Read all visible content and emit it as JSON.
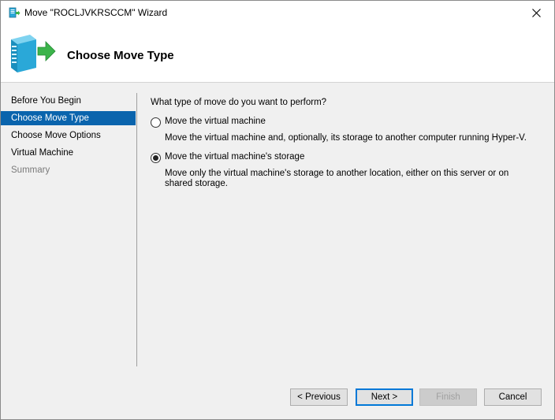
{
  "window": {
    "title": "Move \"ROCLJVKRSCCM\" Wizard",
    "close_glyph": "✕"
  },
  "header": {
    "title": "Choose Move Type"
  },
  "sidebar": {
    "items": [
      {
        "label": "Before You Begin",
        "state": "normal"
      },
      {
        "label": "Choose Move Type",
        "state": "active"
      },
      {
        "label": "Choose Move Options",
        "state": "normal"
      },
      {
        "label": "Virtual Machine",
        "state": "normal"
      },
      {
        "label": "Summary",
        "state": "disabled"
      }
    ]
  },
  "main": {
    "question": "What type of move do you want to perform?",
    "options": [
      {
        "label": "Move the virtual machine",
        "description": "Move the virtual machine and, optionally, its storage to another computer running Hyper-V.",
        "selected": false
      },
      {
        "label": "Move the virtual machine's storage",
        "description": "Move only the virtual machine's storage to another location, either on this server or on shared storage.",
        "selected": true
      }
    ]
  },
  "buttons": {
    "previous": "< Previous",
    "next": "Next >",
    "finish": "Finish",
    "cancel": "Cancel"
  },
  "colors": {
    "accent": "#0a64ad",
    "arrow": "#3cb44b",
    "server": "#2aa8d8"
  }
}
